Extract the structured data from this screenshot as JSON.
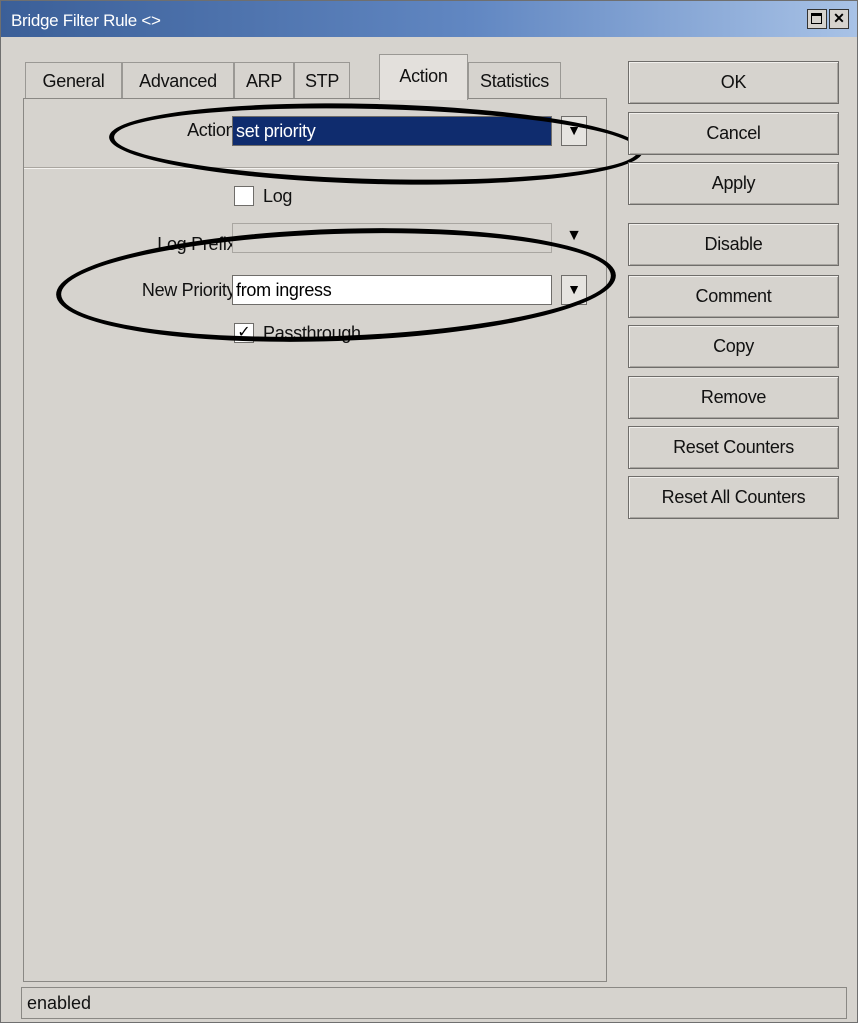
{
  "window": {
    "title": "Bridge Filter Rule <>"
  },
  "tabs": [
    {
      "label": "General"
    },
    {
      "label": "Advanced"
    },
    {
      "label": "ARP"
    },
    {
      "label": "STP"
    },
    {
      "label": "Action"
    },
    {
      "label": "Statistics"
    }
  ],
  "form": {
    "action_label": "Action:",
    "action_value": "set priority",
    "log_label": "Log",
    "log_checked": false,
    "log_prefix_label": "Log Prefix:",
    "log_prefix_value": "",
    "new_priority_label": "New Priority:",
    "new_priority_value": "from ingress",
    "passthrough_label": "Passthrough",
    "passthrough_checked": true
  },
  "buttons": {
    "ok": "OK",
    "cancel": "Cancel",
    "apply": "Apply",
    "disable": "Disable",
    "comment": "Comment",
    "copy": "Copy",
    "remove": "Remove",
    "reset_counters": "Reset Counters",
    "reset_all_counters": "Reset All Counters"
  },
  "status": {
    "text": "enabled"
  },
  "icons": {
    "close": "close-icon",
    "restore": "restore-icon",
    "dropdown": "dropdown-arrow-icon"
  }
}
